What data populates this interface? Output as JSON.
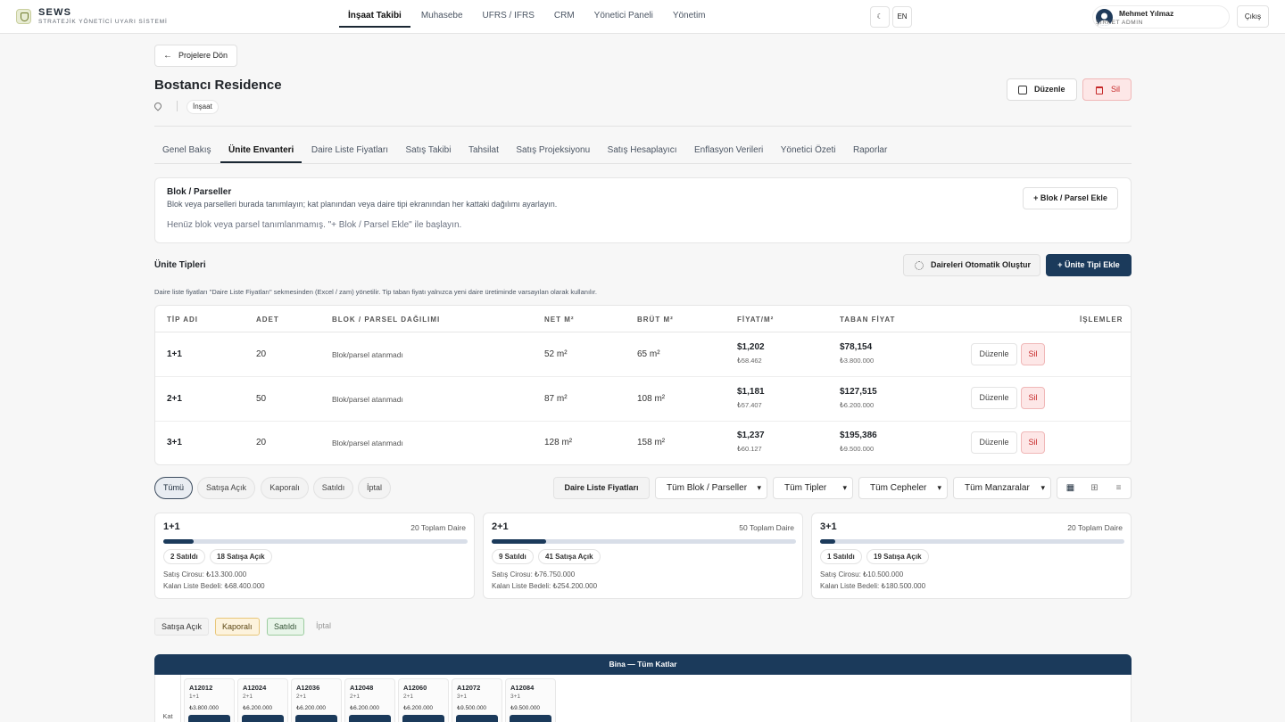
{
  "brand": {
    "title": "SEWS",
    "subtitle": "STRATEJİK YÖNETİCİ UYARI SİSTEMİ"
  },
  "nav": [
    "İnşaat Takibi",
    "Muhasebe",
    "UFRS / IFRS",
    "CRM",
    "Yönetici Paneli",
    "Yönetim"
  ],
  "lang": "EN",
  "user": {
    "name": "Mehmet Yılmaz",
    "role": "ŞİRKET ADMIN"
  },
  "logout": "Çıkış",
  "back": "Projelere Dön",
  "project": {
    "title": "Bostancı Residence",
    "category": "İnşaat"
  },
  "actions": {
    "edit": "Düzenle",
    "delete": "Sil"
  },
  "tabs": [
    "Genel Bakış",
    "Ünite Envanteri",
    "Daire Liste Fiyatları",
    "Satış Takibi",
    "Tahsilat",
    "Satış Projeksiyonu",
    "Satış Hesaplayıcı",
    "Enflasyon Verileri",
    "Yönetici Özeti",
    "Raporlar"
  ],
  "blocks": {
    "title": "Blok / Parseller",
    "desc": "Blok veya parselleri burada tanımlayın; kat planından veya daire tipi ekranından her kattaki dağılımı ayarlayın.",
    "empty": "Henüz blok veya parsel tanımlanmamış. \"+ Blok / Parsel Ekle\" ile başlayın.",
    "add": "+ Blok / Parsel Ekle"
  },
  "unit_types": {
    "title": "Ünite Tipleri",
    "auto": "Daireleri Otomatik Oluştur",
    "add": "+ Ünite Tipi Ekle",
    "note": "Daire liste fiyatları \"Daire Liste Fiyatları\" sekmesinden (Excel / zam) yönetilir. Tip taban fiyatı yalnızca yeni daire üretiminde varsayılan olarak kullanılır."
  },
  "table": {
    "headers": [
      "TİP ADI",
      "ADET",
      "BLOK / PARSEL DAĞILIMI",
      "NET M²",
      "BRÜT M²",
      "FİYAT/M²",
      "TABAN FİYAT",
      "İŞLEMLER"
    ],
    "rows": [
      {
        "type": "1+1",
        "count": "20",
        "block": "Blok/parsel atanmadı",
        "net": "52 m²",
        "gross": "65 m²",
        "ppm": "$1,202",
        "ppm_try": "₺58.462",
        "base": "$78,154",
        "base_try": "₺3.800.000",
        "edit": "Düzenle",
        "del": "Sil"
      },
      {
        "type": "2+1",
        "count": "50",
        "block": "Blok/parsel atanmadı",
        "net": "87 m²",
        "gross": "108 m²",
        "ppm": "$1,181",
        "ppm_try": "₺57.407",
        "base": "$127,515",
        "base_try": "₺6.200.000",
        "edit": "Düzenle",
        "del": "Sil"
      },
      {
        "type": "3+1",
        "count": "20",
        "block": "Blok/parsel atanmadı",
        "net": "128 m²",
        "gross": "158 m²",
        "ppm": "$1,237",
        "ppm_try": "₺60.127",
        "base": "$195,386",
        "base_try": "₺9.500.000",
        "edit": "Düzenle",
        "del": "Sil"
      }
    ]
  },
  "filters": {
    "status": [
      "Tümü",
      "Satışa Açık",
      "Kaporalı",
      "Satıldı",
      "İptal"
    ],
    "price_list": "Daire Liste Fiyatları",
    "selects": [
      "Tüm Blok / Parseller",
      "Tüm Tipler",
      "Tüm Cepheler",
      "Tüm Manzaralar"
    ]
  },
  "summary": [
    {
      "type": "1+1",
      "total": "20 Toplam Daire",
      "sold_fraction": 0.1,
      "sold": "2 Satıldı",
      "open": "18 Satışa Açık",
      "revenue": "Satış Cirosu: ₺13.300.000",
      "remaining": "Kalan Liste Bedeli: ₺68.400.000"
    },
    {
      "type": "2+1",
      "total": "50 Toplam Daire",
      "sold_fraction": 0.18,
      "sold": "9 Satıldı",
      "open": "41 Satışa Açık",
      "revenue": "Satış Cirosu: ₺76.750.000",
      "remaining": "Kalan Liste Bedeli: ₺254.200.000"
    },
    {
      "type": "3+1",
      "total": "20 Toplam Daire",
      "sold_fraction": 0.05,
      "sold": "1 Satıldı",
      "open": "19 Satışa Açık",
      "revenue": "Satış Cirosu: ₺10.500.000",
      "remaining": "Kalan Liste Bedeli: ₺180.500.000"
    }
  ],
  "legend": [
    "Satışa Açık",
    "Kaporalı",
    "Satıldı",
    "İptal"
  ],
  "building": {
    "title": "Bina — Tüm Katlar",
    "floor_label": "Kat",
    "units": [
      {
        "code": "A12012",
        "type": "1+1",
        "price": "₺3.800.000"
      },
      {
        "code": "A12024",
        "type": "2+1",
        "price": "₺6.200.000"
      },
      {
        "code": "A12036",
        "type": "2+1",
        "price": "₺6.200.000"
      },
      {
        "code": "A12048",
        "type": "2+1",
        "price": "₺6.200.000"
      },
      {
        "code": "A12060",
        "type": "2+1",
        "price": "₺6.200.000"
      },
      {
        "code": "A12072",
        "type": "3+1",
        "price": "₺9.500.000"
      },
      {
        "code": "A12084",
        "type": "3+1",
        "price": "₺9.500.000"
      }
    ]
  },
  "colors": {
    "primary": "#1b3a5b",
    "danger": "#c62828",
    "danger_bg": "#fde7e7"
  }
}
